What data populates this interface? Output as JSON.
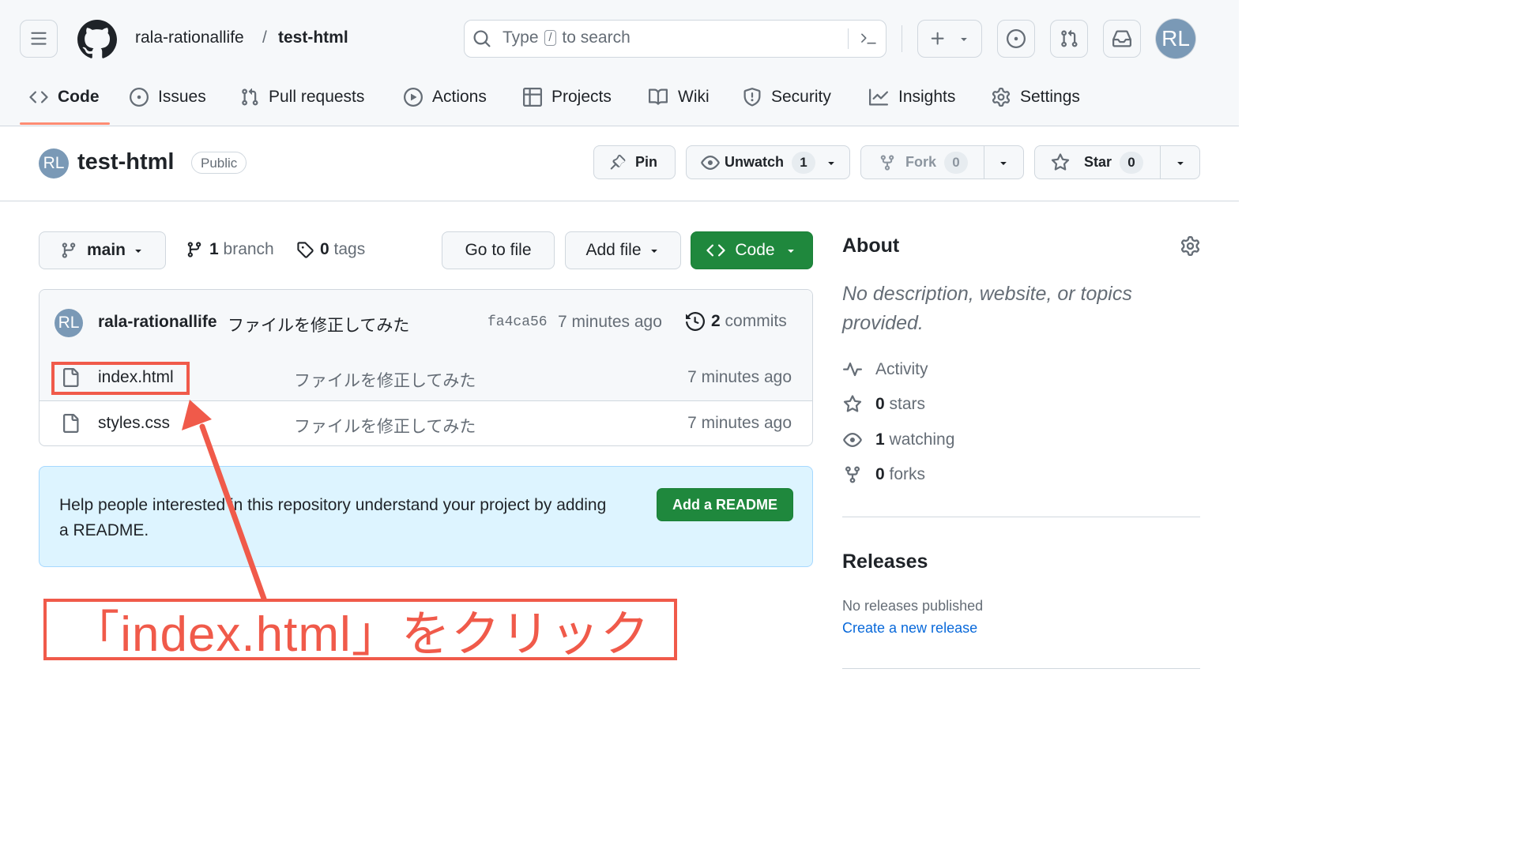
{
  "header": {
    "owner": "rala-rationallife",
    "separator": "/",
    "repo": "test-html",
    "search_prefix": "Type",
    "search_key": "/",
    "search_suffix": "to search",
    "avatar_initials": "RL"
  },
  "repo_nav": [
    {
      "label": "Code",
      "icon": "code-icon",
      "active": true
    },
    {
      "label": "Issues",
      "icon": "issue-opened-icon"
    },
    {
      "label": "Pull requests",
      "icon": "git-pull-request-icon"
    },
    {
      "label": "Actions",
      "icon": "play-icon"
    },
    {
      "label": "Projects",
      "icon": "table-icon"
    },
    {
      "label": "Wiki",
      "icon": "book-icon"
    },
    {
      "label": "Security",
      "icon": "shield-icon"
    },
    {
      "label": "Insights",
      "icon": "graph-icon"
    },
    {
      "label": "Settings",
      "icon": "gear-icon"
    }
  ],
  "repo_header": {
    "avatar_initials": "RL",
    "title": "test-html",
    "visibility": "Public",
    "pin_label": "Pin",
    "unwatch_label": "Unwatch",
    "unwatch_count": "1",
    "fork_label": "Fork",
    "fork_count": "0",
    "star_label": "Star",
    "star_count": "0"
  },
  "toolbar": {
    "branch": "main",
    "branch_count": "1",
    "branch_word": "branch",
    "tag_count": "0",
    "tag_word": "tags",
    "go_to_file": "Go to file",
    "add_file": "Add file",
    "code": "Code"
  },
  "latest_commit": {
    "avatar_initials": "RL",
    "author": "rala-rationallife",
    "message": "ファイルを修正してみた",
    "sha": "fa4ca56",
    "time": "7 minutes ago",
    "commit_count": "2",
    "commit_word": "commits"
  },
  "files": [
    {
      "name": "index.html",
      "message": "ファイルを修正してみた",
      "time": "7 minutes ago"
    },
    {
      "name": "styles.css",
      "message": "ファイルを修正してみた",
      "time": "7 minutes ago"
    }
  ],
  "readme_prompt": {
    "text": "Help people interested in this repository understand your project by adding a README.",
    "button": "Add a README"
  },
  "about": {
    "title": "About",
    "description": "No description, website, or topics provided.",
    "activity": "Activity",
    "stars_count": "0",
    "stars_word": "stars",
    "watching_count": "1",
    "watching_word": "watching",
    "forks_count": "0",
    "forks_word": "forks"
  },
  "releases": {
    "title": "Releases",
    "none": "No releases published",
    "create_link": "Create a new release"
  },
  "annotation": {
    "text": "「index.html」をクリック",
    "color": "#f05a4a"
  },
  "colors": {
    "accent_green": "#1f883d",
    "link_blue": "#0969da",
    "nav_underline": "#fd8c73"
  }
}
